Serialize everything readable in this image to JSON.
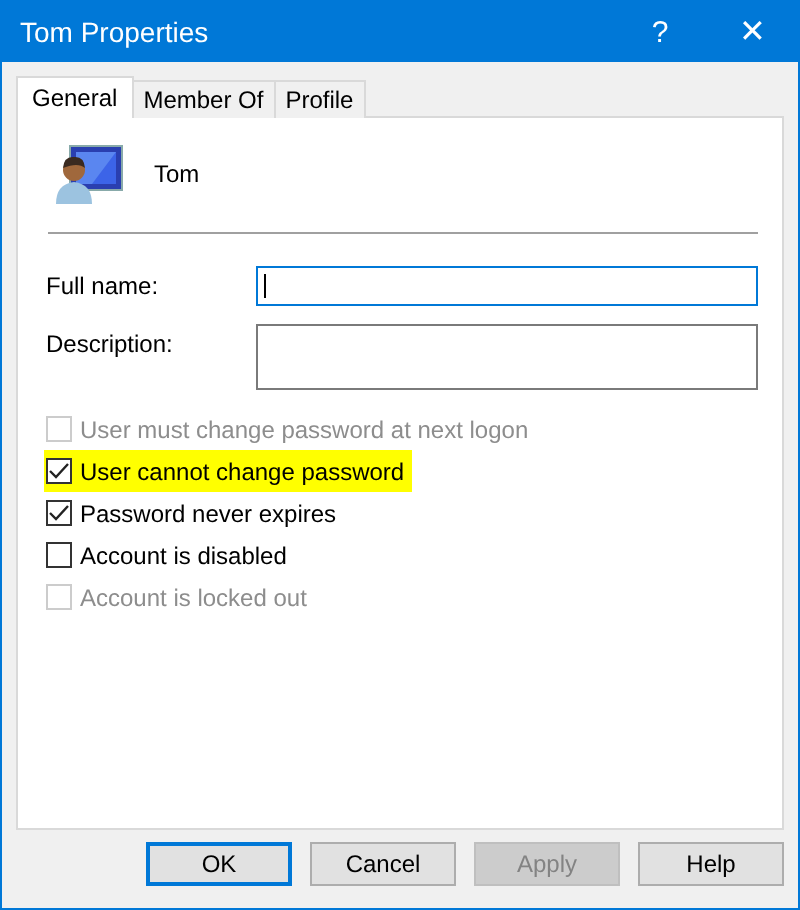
{
  "window": {
    "title": "Tom Properties",
    "help": "?",
    "close": "✕"
  },
  "tabs": [
    {
      "label": "General",
      "selected": true
    },
    {
      "label": "Member Of",
      "selected": false
    },
    {
      "label": "Profile",
      "selected": false
    }
  ],
  "user": {
    "name": "Tom"
  },
  "fields": [
    {
      "label": "Full name:",
      "focused": true,
      "multiline": false
    },
    {
      "label": "Description:",
      "focused": false,
      "multiline": true
    }
  ],
  "options": [
    {
      "label": "User must change password at next logon",
      "checked": false,
      "disabled": true,
      "highlighted": false
    },
    {
      "label": "User cannot change password",
      "checked": true,
      "disabled": false,
      "highlighted": true
    },
    {
      "label": "Password never expires",
      "checked": true,
      "disabled": false,
      "highlighted": false
    },
    {
      "label": "Account is disabled",
      "checked": false,
      "disabled": false,
      "highlighted": false
    },
    {
      "label": "Account is locked out",
      "checked": false,
      "disabled": true,
      "highlighted": false
    }
  ],
  "buttons": [
    {
      "label": "OK",
      "default": true,
      "disabled": false
    },
    {
      "label": "Cancel",
      "default": false,
      "disabled": false
    },
    {
      "label": "Apply",
      "default": false,
      "disabled": true
    },
    {
      "label": "Help",
      "default": false,
      "disabled": false
    }
  ]
}
